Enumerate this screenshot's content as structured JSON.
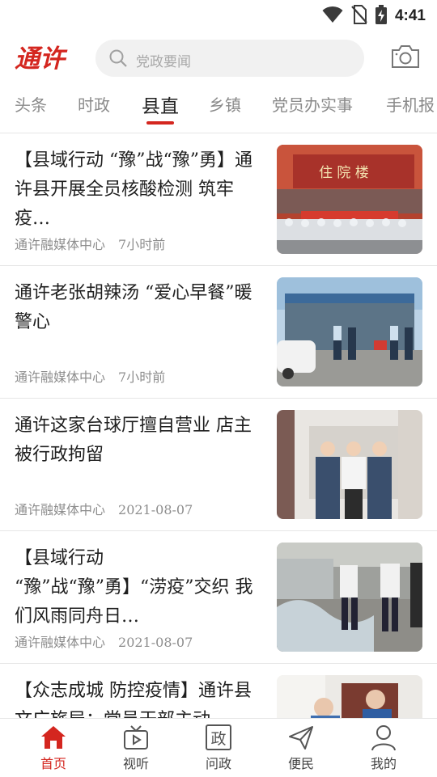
{
  "status_bar": {
    "time": "4:41",
    "icons": [
      "wifi-icon",
      "no-sim-icon",
      "battery-charging-icon"
    ]
  },
  "header": {
    "logo_text": "通许",
    "search_placeholder": "党政要闻",
    "camera_icon": "camera-icon"
  },
  "tabs": [
    {
      "label": "头条",
      "active": false
    },
    {
      "label": "时政",
      "active": false
    },
    {
      "label": "县直",
      "active": true
    },
    {
      "label": "乡镇",
      "active": false
    },
    {
      "label": "党员办实事",
      "active": false
    },
    {
      "label": "手机报",
      "active": false
    }
  ],
  "news": [
    {
      "title": "【县域行动 “豫”战“豫”勇】通许县开展全员核酸检测 筑牢疫…",
      "source": "通许融媒体中心",
      "time": "7小时前",
      "thumb_text": "住 院 楼"
    },
    {
      "title": "通许老张胡辣汤 “爱心早餐”暖警心",
      "source": "通许融媒体中心",
      "time": "7小时前"
    },
    {
      "title": "通许这家台球厅擅自营业 店主被行政拘留",
      "source": "通许融媒体中心",
      "time": "2021-08-07"
    },
    {
      "title": "【县域行动 “豫”战“豫”勇】“涝疫”交织 我们风雨同舟日…",
      "source": "通许融媒体中心",
      "time": "2021-08-07"
    },
    {
      "title": "【众志成城 防控疫情】通许县文广旅局：党员干部主动…",
      "source": "",
      "time": ""
    }
  ],
  "bottom_nav": [
    {
      "label": "首页",
      "icon": "home-icon",
      "active": true
    },
    {
      "label": "视听",
      "icon": "tv-icon",
      "active": false
    },
    {
      "label": "问政",
      "icon": "zheng-icon",
      "active": false
    },
    {
      "label": "便民",
      "icon": "paper-plane-icon",
      "active": false
    },
    {
      "label": "我的",
      "icon": "person-icon",
      "active": false
    }
  ],
  "colors": {
    "accent": "#d4261f",
    "tab_inactive": "#8a8a8a",
    "meta": "#8d8d8d"
  }
}
